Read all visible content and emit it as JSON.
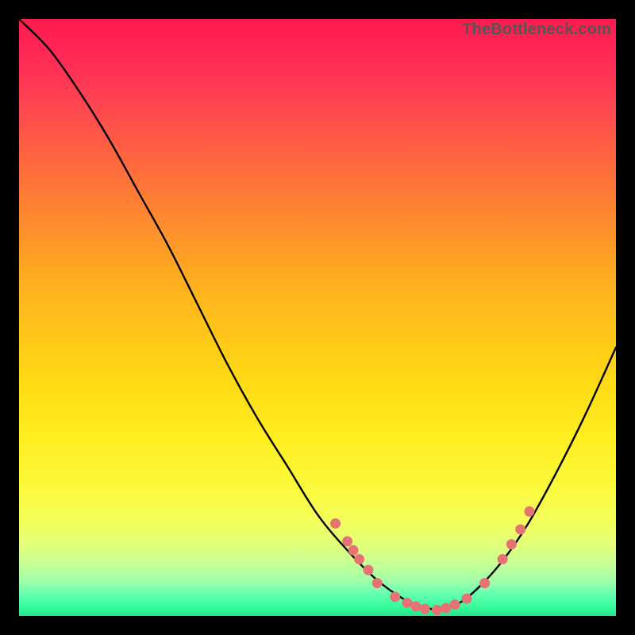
{
  "watermark": "TheBottleneck.com",
  "chart_data": {
    "type": "line",
    "title": "",
    "xlabel": "",
    "ylabel": "",
    "xlim": [
      0,
      100
    ],
    "ylim": [
      0,
      100
    ],
    "series": [
      {
        "name": "bottleneck-curve",
        "x": [
          0,
          5,
          10,
          15,
          20,
          25,
          30,
          35,
          40,
          45,
          50,
          55,
          60,
          65,
          68,
          70,
          72,
          75,
          80,
          85,
          90,
          95,
          100
        ],
        "y": [
          100,
          95,
          88,
          80,
          71,
          62,
          52,
          42,
          33,
          25,
          17,
          11,
          6,
          2.5,
          1.5,
          1,
          1.5,
          3,
          8,
          15,
          24,
          34,
          45
        ]
      }
    ],
    "markers": [
      {
        "x": 53,
        "y": 15.5
      },
      {
        "x": 55,
        "y": 12.5
      },
      {
        "x": 56,
        "y": 11
      },
      {
        "x": 57,
        "y": 9.5
      },
      {
        "x": 58.5,
        "y": 7.7
      },
      {
        "x": 60,
        "y": 5.5
      },
      {
        "x": 63,
        "y": 3.2
      },
      {
        "x": 65,
        "y": 2.2
      },
      {
        "x": 66.5,
        "y": 1.6
      },
      {
        "x": 68,
        "y": 1.2
      },
      {
        "x": 70,
        "y": 1
      },
      {
        "x": 71.5,
        "y": 1.3
      },
      {
        "x": 73,
        "y": 1.9
      },
      {
        "x": 75,
        "y": 2.9
      },
      {
        "x": 78,
        "y": 5.5
      },
      {
        "x": 81,
        "y": 9.5
      },
      {
        "x": 82.5,
        "y": 12
      },
      {
        "x": 84,
        "y": 14.5
      },
      {
        "x": 85.5,
        "y": 17.5
      }
    ],
    "marker_color": "#e57373",
    "curve_color": "#000000"
  }
}
